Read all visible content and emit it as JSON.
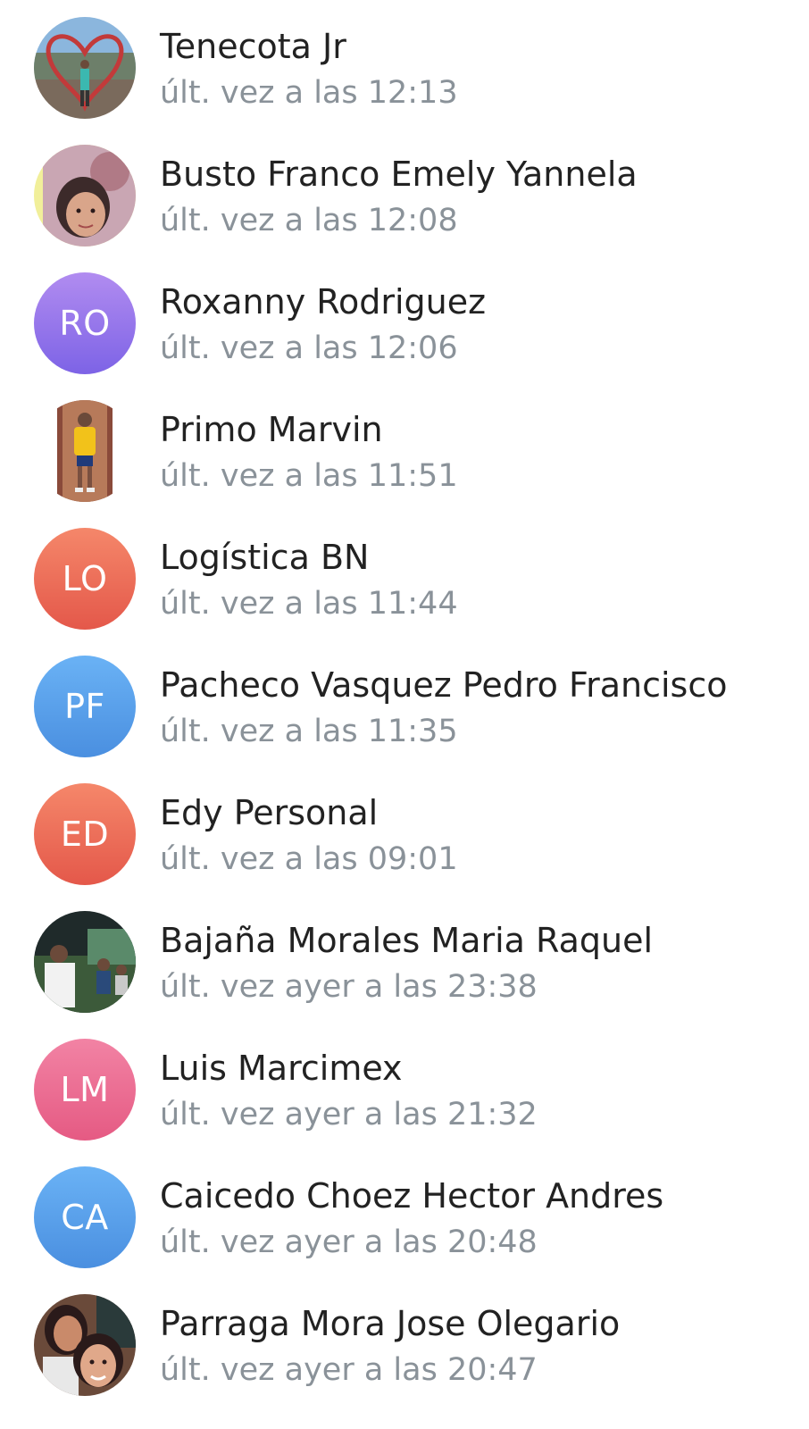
{
  "contacts": [
    {
      "name": "Tenecota Jr",
      "status": "últ. vez a las 12:13",
      "avatar_type": "photo",
      "avatar_subject": "person-with-heart-frame"
    },
    {
      "name": "Busto Franco Emely Yannela",
      "status": "últ. vez a las 12:08",
      "avatar_type": "photo",
      "avatar_subject": "girl-portrait"
    },
    {
      "name": "Roxanny Rodriguez",
      "status": "últ. vez a las 12:06",
      "avatar_type": "initials",
      "initials": "RO",
      "color_top": "#b18cf0",
      "color_bottom": "#7d63e6"
    },
    {
      "name": "Primo Marvin",
      "status": "últ. vez a las 11:51",
      "avatar_type": "photo",
      "avatar_subject": "man-yellow-shirt"
    },
    {
      "name": "Logística BN",
      "status": "últ. vez a las 11:44",
      "avatar_type": "initials",
      "initials": "LO",
      "color_top": "#f5876a",
      "color_bottom": "#e4584a"
    },
    {
      "name": "Pacheco Vasquez Pedro Francisco",
      "status": "últ. vez a las 11:35",
      "avatar_type": "initials",
      "initials": "PF",
      "color_top": "#6ab2f5",
      "color_bottom": "#4a8fe0"
    },
    {
      "name": "Edy Personal",
      "status": "últ. vez a las 09:01",
      "avatar_type": "initials",
      "initials": "ED",
      "color_top": "#f5876a",
      "color_bottom": "#e4584a"
    },
    {
      "name": "Bajaña Morales Maria Raquel",
      "status": "últ. vez ayer a las 23:38",
      "avatar_type": "photo",
      "avatar_subject": "group-photo"
    },
    {
      "name": "Luis Marcimex",
      "status": "últ. vez ayer a las 21:32",
      "avatar_type": "initials",
      "initials": "LM",
      "color_top": "#f283a4",
      "color_bottom": "#e55a83"
    },
    {
      "name": "Caicedo Choez Hector Andres",
      "status": "últ. vez ayer a las 20:48",
      "avatar_type": "initials",
      "initials": "CA",
      "color_top": "#6ab2f5",
      "color_bottom": "#4a8fe0"
    },
    {
      "name": "Parraga Mora Jose Olegario",
      "status": "últ. vez ayer a las 20:47",
      "avatar_type": "photo",
      "avatar_subject": "two-women-portrait"
    }
  ]
}
